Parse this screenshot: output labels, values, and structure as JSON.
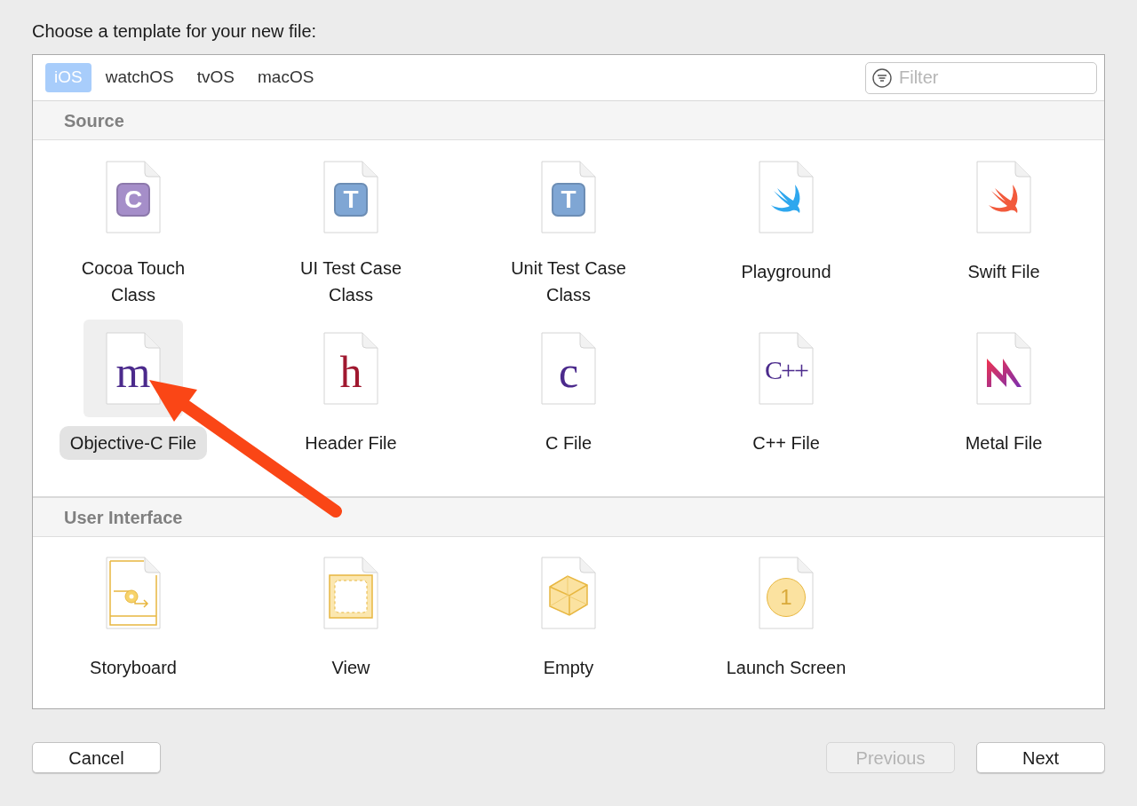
{
  "prompt": "Choose a template for your new file:",
  "tabs": [
    {
      "label": "iOS",
      "selected": true
    },
    {
      "label": "watchOS",
      "selected": false
    },
    {
      "label": "tvOS",
      "selected": false
    },
    {
      "label": "macOS",
      "selected": false
    }
  ],
  "filter": {
    "placeholder": "Filter"
  },
  "sections": [
    {
      "title": "Source",
      "items": [
        {
          "label": "Cocoa Touch\nClass",
          "kind": "badge",
          "glyph": "C",
          "color": "#a58ec9",
          "selected": false
        },
        {
          "label": "UI Test Case\nClass",
          "kind": "badge",
          "glyph": "T",
          "color": "#7fa6d4",
          "selected": false
        },
        {
          "label": "Unit Test Case\nClass",
          "kind": "badge",
          "glyph": "T",
          "color": "#7fa6d4",
          "selected": false
        },
        {
          "label": "Playground",
          "kind": "swift",
          "color": "#2ea7ee",
          "selected": false
        },
        {
          "label": "Swift File",
          "kind": "swift",
          "color": "#f25a3c",
          "selected": false
        },
        {
          "label": "Objective-C File",
          "kind": "letter",
          "glyph": "m",
          "color": "#4b2a8c",
          "selected": true
        },
        {
          "label": "Header File",
          "kind": "letter",
          "glyph": "h",
          "color": "#a0182f",
          "selected": false
        },
        {
          "label": "C File",
          "kind": "letter",
          "glyph": "c",
          "color": "#4b2a8c",
          "selected": false
        },
        {
          "label": "C++ File",
          "kind": "letter",
          "glyph": "C++",
          "color": "#4b2a8c",
          "selected": false
        },
        {
          "label": "Metal File",
          "kind": "metal",
          "selected": false
        }
      ]
    },
    {
      "title": "User Interface",
      "items": [
        {
          "label": "Storyboard",
          "kind": "storyboard",
          "selected": false
        },
        {
          "label": "View",
          "kind": "view",
          "selected": false
        },
        {
          "label": "Empty",
          "kind": "empty",
          "selected": false
        },
        {
          "label": "Launch Screen",
          "kind": "launch",
          "glyph": "1",
          "selected": false
        }
      ]
    }
  ],
  "buttons": [
    {
      "label": "Cancel",
      "disabled": false
    },
    {
      "label": "Previous",
      "disabled": true
    },
    {
      "label": "Next",
      "disabled": false
    }
  ]
}
